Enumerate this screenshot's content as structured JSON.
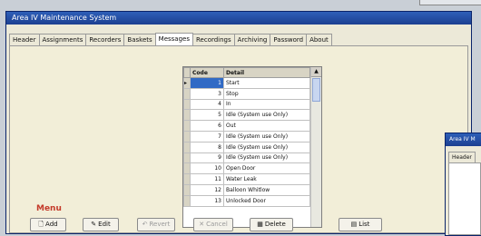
{
  "window": {
    "title": "Area IV Maintenance System"
  },
  "tabs": [
    "Header",
    "Assignments",
    "Recorders",
    "Baskets",
    "Messages",
    "Recordings",
    "Archiving",
    "Password",
    "About"
  ],
  "grid": {
    "headers": {
      "code": "Code",
      "detail": "Detail"
    },
    "rows": [
      {
        "code": "1",
        "detail": "Start"
      },
      {
        "code": "3",
        "detail": "Stop"
      },
      {
        "code": "4",
        "detail": "In"
      },
      {
        "code": "5",
        "detail": "Idle (System use Only)"
      },
      {
        "code": "6",
        "detail": "Out"
      },
      {
        "code": "7",
        "detail": "Idle (System use Only)"
      },
      {
        "code": "8",
        "detail": "Idle (System use Only)"
      },
      {
        "code": "9",
        "detail": "Idle (System use Only)"
      },
      {
        "code": "10",
        "detail": "Open Door"
      },
      {
        "code": "11",
        "detail": "Water Leak"
      },
      {
        "code": "12",
        "detail": "Balloon Whitlow"
      },
      {
        "code": "13",
        "detail": "Unlocked Door"
      }
    ]
  },
  "menu": {
    "label": "Menu",
    "buttons": {
      "add": "Add",
      "edit": "Edit",
      "revert": "Revert",
      "cancel": "Cancel",
      "delete": "Delete",
      "list": "List"
    }
  },
  "side_window": {
    "title": "Area IV M",
    "tab": "Header"
  },
  "colors": {
    "titlebar": "#1c3f91",
    "selection": "#316ac5",
    "menu_label": "#c43a2a"
  }
}
